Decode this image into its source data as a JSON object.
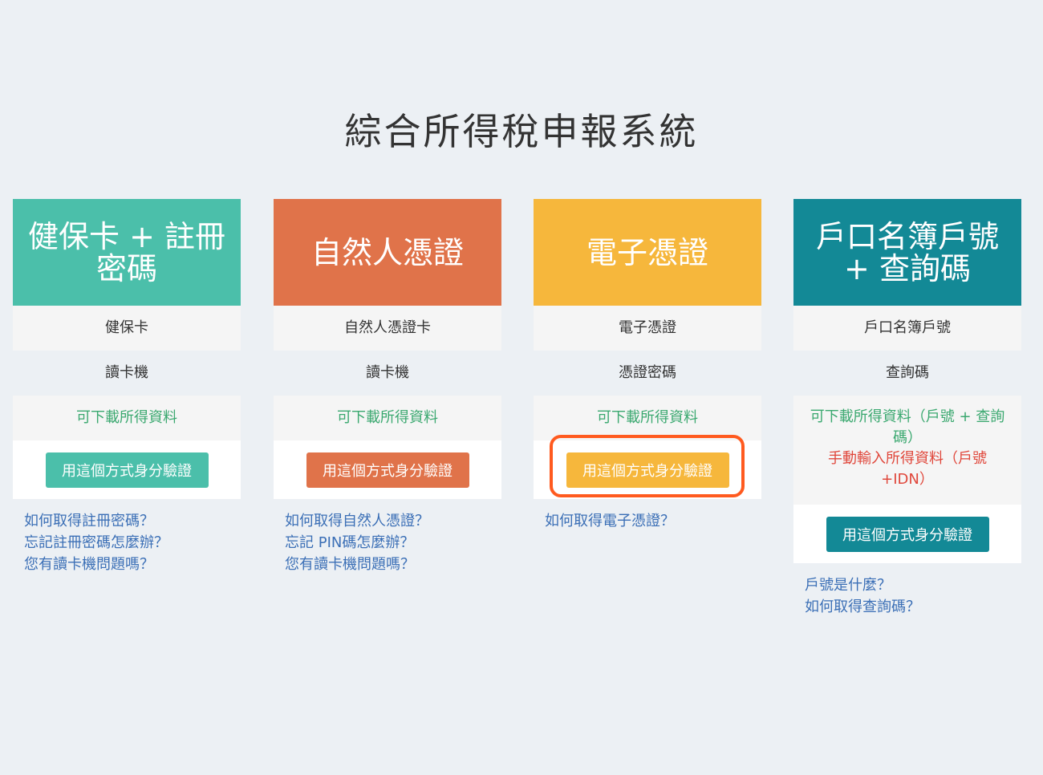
{
  "page": {
    "title": "綜合所得稅申報系統"
  },
  "colors": {
    "card1": "#4bbfaa",
    "card2": "#e0734a",
    "card3": "#f6b73c",
    "card4": "#138996",
    "highlight": "#ff5a1f"
  },
  "cards": [
    {
      "title": "健保卡 + 註冊密碼",
      "device": "健保卡",
      "reader": "讀卡機",
      "download": "可下載所得資料",
      "button": "用這個方式身分驗證",
      "links": [
        "如何取得註冊密碼？",
        "忘記註冊密碼怎麼辦？",
        "您有讀卡機問題嗎？"
      ]
    },
    {
      "title": "自然人憑證",
      "device": "自然人憑證卡",
      "reader": "讀卡機",
      "download": "可下載所得資料",
      "button": "用這個方式身分驗證",
      "links": [
        "如何取得自然人憑證？",
        "忘記 PIN碼怎麼辦？",
        "您有讀卡機問題嗎？"
      ]
    },
    {
      "title": "電子憑證",
      "device": "電子憑證",
      "reader": "憑證密碼",
      "download": "可下載所得資料",
      "button": "用這個方式身分驗證",
      "links": [
        "如何取得電子憑證？"
      ]
    },
    {
      "title": "戶口名簿戶號 + 查詢碼",
      "device": "戶口名簿戶號",
      "reader": "查詢碼",
      "download": "可下載所得資料（戶號 + 查詢碼）",
      "manual": "手動輸入所得資料（戶號 +IDN）",
      "button": "用這個方式身分驗證",
      "links": [
        "戶號是什麼？",
        "如何取得查詢碼？"
      ]
    }
  ]
}
